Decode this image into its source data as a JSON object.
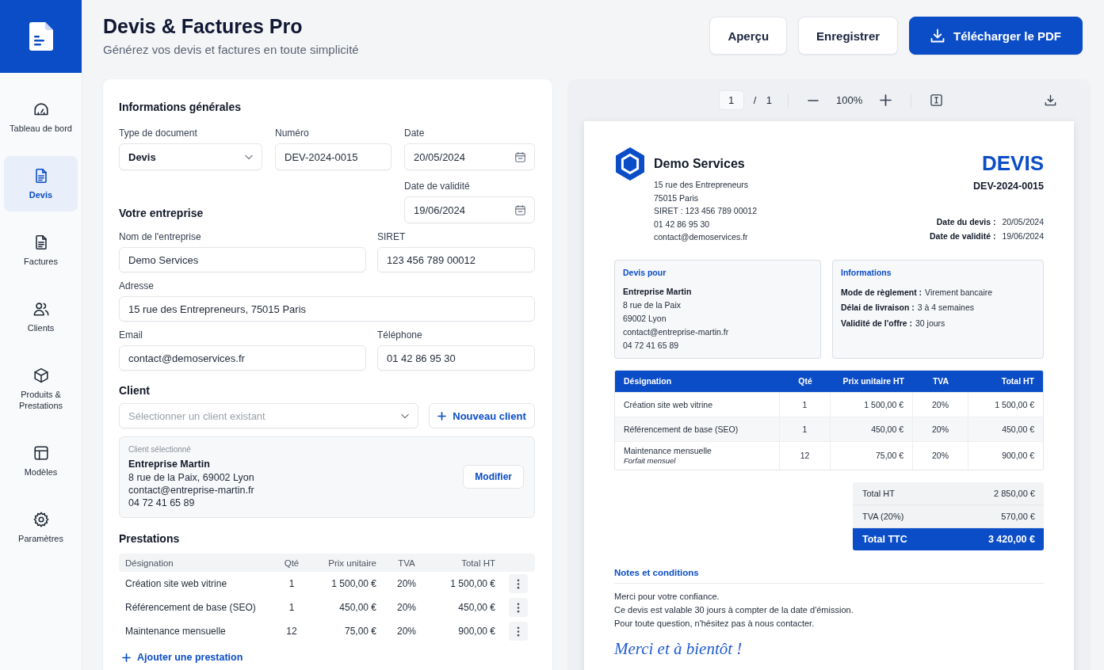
{
  "sidebar": {
    "items": [
      {
        "label": "Tableau de bord",
        "selected": false
      },
      {
        "label": "Devis",
        "selected": true
      },
      {
        "label": "Factures",
        "selected": false
      },
      {
        "label": "Clients",
        "selected": false
      },
      {
        "label": "Produits & Prestations",
        "selected": false
      },
      {
        "label": "Modèles",
        "selected": false
      },
      {
        "label": "Paramètres",
        "selected": false
      }
    ]
  },
  "header": {
    "title": "Devis & Factures Pro",
    "subtitle": "Générez vos devis et factures en toute simplicité",
    "actions": [
      {
        "label": "Aperçu",
        "kind": "secondary"
      },
      {
        "label": "Enregistrer",
        "kind": "secondary"
      },
      {
        "label": "Télécharger le PDF",
        "kind": "primary"
      }
    ]
  },
  "form": {
    "general": {
      "title": "Informations générales",
      "fields": [
        {
          "label": "Type de document",
          "value": "Devis",
          "kind": "select"
        },
        {
          "label": "Numéro",
          "value": "DEV-2024-0015",
          "kind": "text"
        },
        {
          "label": "Date",
          "value": "20/05/2024",
          "kind": "date"
        },
        {
          "label": "Date de validité",
          "value": "19/06/2024",
          "kind": "date"
        }
      ]
    },
    "company": {
      "title": "Votre entreprise",
      "fields": [
        {
          "label": "Nom de l'entreprise",
          "value": "Demo Services"
        },
        {
          "label": "SIRET",
          "value": "123 456 789 00012"
        },
        {
          "label": "Adresse",
          "value": "15 rue des Entrepreneurs, 75015 Paris"
        },
        {
          "label": "Email",
          "value": "contact@demoservices.fr"
        },
        {
          "label": "Téléphone",
          "value": "01 42 86 95 30"
        }
      ]
    },
    "client": {
      "title": "Client",
      "select": {
        "placeholder": "Sélectionner un client existant"
      },
      "new_button": "Nouveau client",
      "selected_client": {
        "caption": "Client sélectionné",
        "name": "Entreprise Martin",
        "lines": [
          "8 rue de la Paix, 69002 Lyon",
          "contact@entreprise-martin.fr",
          "04 72 41 65 89"
        ],
        "edit_button": "Modifier"
      }
    },
    "services": {
      "title": "Prestations",
      "columns": [
        "Désignation",
        "Qté",
        "Prix unitaire",
        "TVA",
        "Total HT"
      ],
      "rows": [
        {
          "cells": [
            "Création site web vitrine",
            "1",
            "1 500,00 €",
            "20%",
            "1 500,00 €"
          ]
        },
        {
          "cells": [
            "Référencement de base (SEO)",
            "1",
            "450,00 €",
            "20%",
            "450,00 €"
          ]
        },
        {
          "cells": [
            "Maintenance mensuelle",
            "12",
            "75,00 €",
            "20%",
            "900,00 €"
          ]
        }
      ],
      "add_button": "Ajouter une prestation"
    }
  },
  "preview": {
    "toolbar": {
      "page": "1",
      "page_count": "/ 1",
      "zoom": "100%"
    },
    "document": {
      "issuer": {
        "name": "Demo Services",
        "lines": [
          "15 rue des Entrepreneurs",
          "75015 Paris",
          "SIRET : 123 456 789 00012",
          "01 42 86 95 30",
          "contact@demoservices.fr"
        ]
      },
      "doc_type": "DEVIS",
      "number": "DEV-2024-0015",
      "dates": [
        {
          "label": "Date du devis :",
          "value": "20/05/2024"
        },
        {
          "label": "Date de validité :",
          "value": "19/06/2024"
        }
      ],
      "recipient": {
        "title": "Devis pour",
        "name": "Entreprise Martin",
        "lines": [
          "8 rue de la Paix",
          "69002 Lyon",
          "contact@entreprise-martin.fr",
          "04 72 41 65 89"
        ]
      },
      "info": {
        "title": "Informations",
        "items": [
          {
            "label": "Mode de règlement :",
            "value": "Virement bancaire"
          },
          {
            "label": "Délai de livraison :",
            "value": "3 à 4 semaines"
          },
          {
            "label": "Validité de l'offre :",
            "value": "30 jours"
          }
        ]
      },
      "table": {
        "columns": [
          "Désignation",
          "Qté",
          "Prix unitaire HT",
          "TVA",
          "Total HT"
        ],
        "rows": [
          {
            "cells": [
              "Création site web vitrine",
              "1",
              "1 500,00 €",
              "20%",
              "1 500,00 €"
            ]
          },
          {
            "cells": [
              "Référencement de base (SEO)",
              "1",
              "450,00 €",
              "20%",
              "450,00 €"
            ]
          },
          {
            "cells": [
              "Maintenance mensuelle",
              "12",
              "75,00 €",
              "20%",
              "900,00 €"
            ],
            "note": "Forfait mensuel"
          }
        ]
      },
      "totals": [
        {
          "label": "Total HT",
          "value": "2 850,00 €",
          "kind": "subtotal"
        },
        {
          "label": "TVA (20%)",
          "value": "570,00 €",
          "kind": "subtotal"
        },
        {
          "label": "Total TTC",
          "value": "3 420,00 €",
          "kind": "grand"
        }
      ],
      "notes": {
        "title": "Notes et conditions",
        "lines": [
          "Merci pour votre confiance.",
          "Ce devis est valable 30 jours à compter de la date d'émission.",
          "Pour toute question, n'hésitez pas à nous contacter."
        ]
      },
      "signature": "Merci et à bientôt !"
    }
  }
}
